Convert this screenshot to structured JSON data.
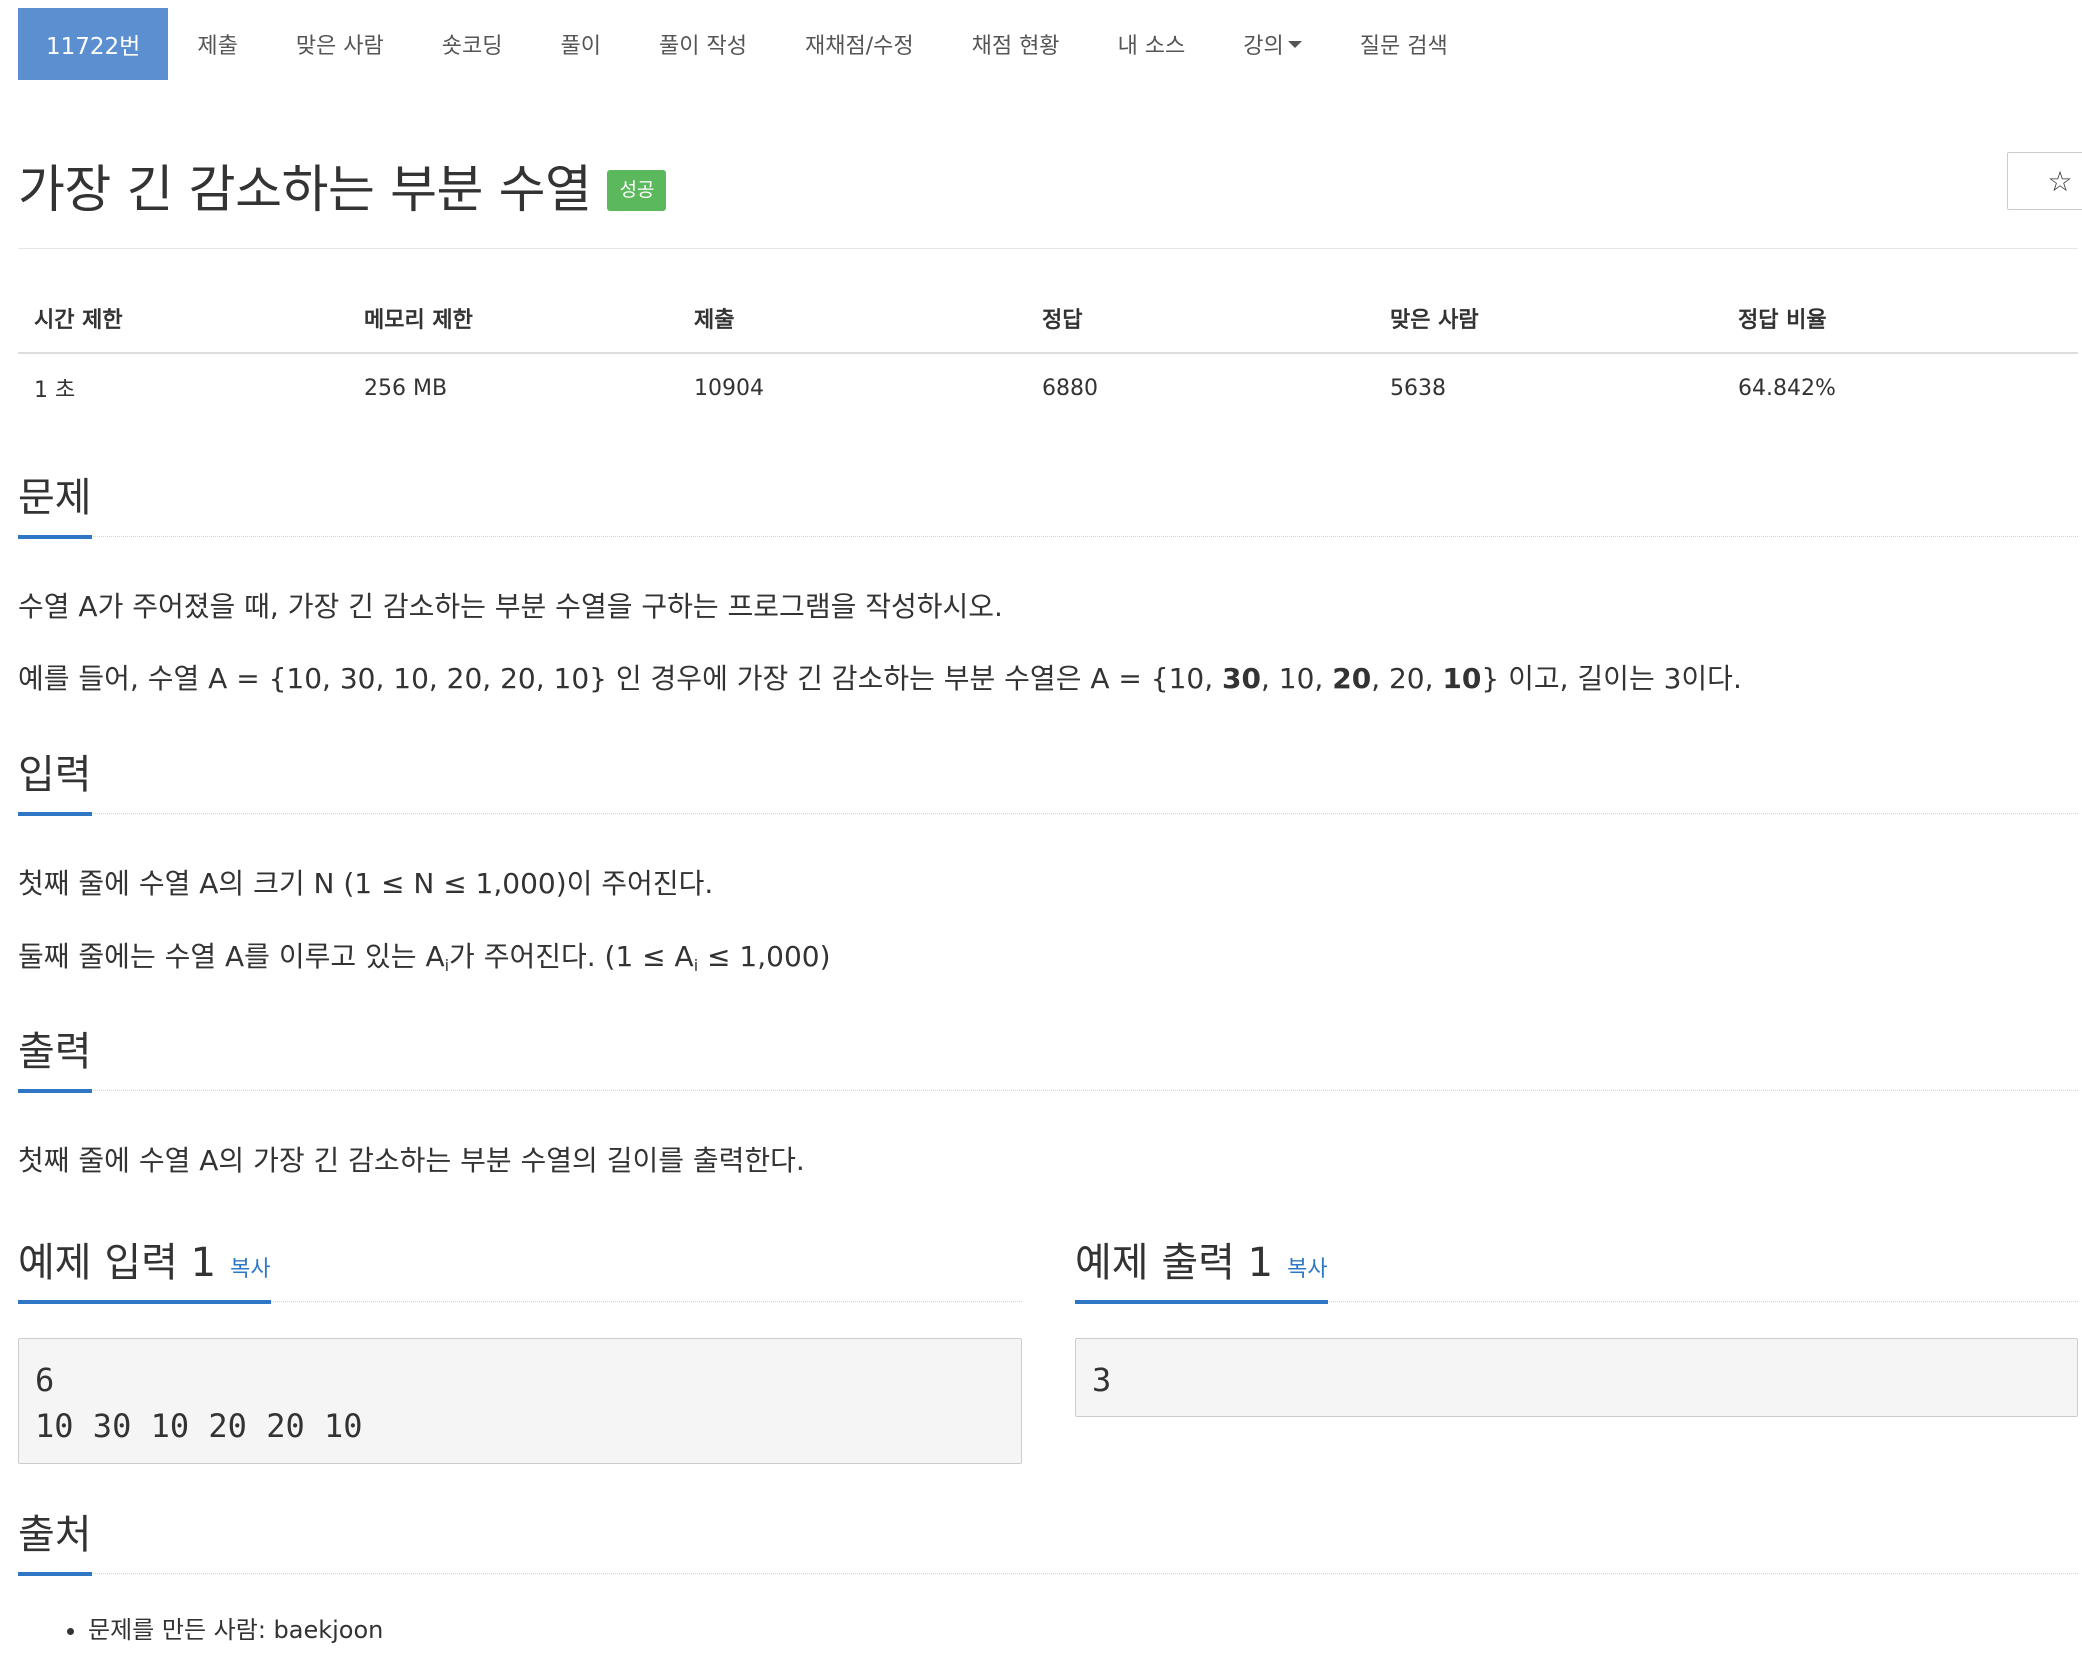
{
  "nav": {
    "items": [
      {
        "label": "11722번",
        "active": true
      },
      {
        "label": "제출"
      },
      {
        "label": "맞은 사람"
      },
      {
        "label": "숏코딩"
      },
      {
        "label": "풀이"
      },
      {
        "label": "풀이 작성"
      },
      {
        "label": "재채점/수정"
      },
      {
        "label": "채점 현황"
      },
      {
        "label": "내 소스"
      },
      {
        "label": "강의",
        "dropdown": true
      },
      {
        "label": "질문 검색"
      }
    ]
  },
  "problem": {
    "title": "가장 긴 감소하는 부분 수열",
    "badge": "성공",
    "star": "☆"
  },
  "info": {
    "headers": [
      "시간 제한",
      "메모리 제한",
      "제출",
      "정답",
      "맞은 사람",
      "정답 비율"
    ],
    "values": [
      "1 초",
      "256 MB",
      "10904",
      "6880",
      "5638",
      "64.842%"
    ]
  },
  "description": {
    "heading": "문제",
    "p1": "수열 A가 주어졌을 때, 가장 긴 감소하는 부분 수열을 구하는 프로그램을 작성하시오.",
    "p2_pre": "예를 들어, 수열 A = {10, 30, 10, 20, 20, 10} 인 경우에 가장 긴 감소하는 부분 수열은 A = {10, ",
    "p2_b1": "30",
    "p2_m1": ", 10, ",
    "p2_b2": "20",
    "p2_m2": ", 20, ",
    "p2_b3": "10",
    "p2_post": "}  이고, 길이는 3이다."
  },
  "input": {
    "heading": "입력",
    "p1": "첫째 줄에 수열 A의 크기 N (1 ≤ N ≤ 1,000)이 주어진다.",
    "p2_a": "둘째 줄에는 수열 A를 이루고 있는 A",
    "p2_sub1": "i",
    "p2_b": "가 주어진다. (1 ≤ A",
    "p2_sub2": "i",
    "p2_c": " ≤ 1,000)"
  },
  "output": {
    "heading": "출력",
    "p1": "첫째 줄에 수열 A의 가장 긴 감소하는 부분 수열의 길이를 출력한다."
  },
  "sample_input": {
    "heading": "예제 입력 1",
    "copy": "복사",
    "text": "6\n10 30 10 20 20 10"
  },
  "sample_output": {
    "heading": "예제 출력 1",
    "copy": "복사",
    "text": "3"
  },
  "source": {
    "heading": "출처",
    "items": [
      "문제를 만든 사람: baekjoon"
    ]
  },
  "colors": {
    "nav_active": "#5b8fcf",
    "badge_success": "#5cb85c",
    "heading_underline": "#2f77c4",
    "link": "#2f77c4"
  }
}
